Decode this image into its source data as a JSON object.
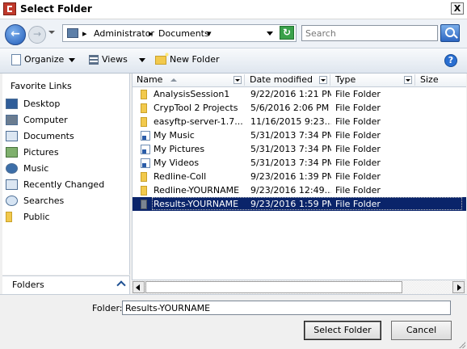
{
  "window": {
    "title": "Select Folder",
    "close_label": "X"
  },
  "address_bar": {
    "breadcrumb": [
      "Administrator",
      "Documents"
    ],
    "search_placeholder": "Search"
  },
  "toolbar": {
    "organize_label": "Organize",
    "views_label": "Views",
    "new_folder_label": "New Folder",
    "help_label": "?"
  },
  "nav_pane": {
    "heading": "Favorite Links",
    "items": [
      {
        "label": "Desktop",
        "icon": "desktop-icon"
      },
      {
        "label": "Computer",
        "icon": "computer-icon"
      },
      {
        "label": "Documents",
        "icon": "documents-icon"
      },
      {
        "label": "Pictures",
        "icon": "pictures-icon"
      },
      {
        "label": "Music",
        "icon": "music-icon"
      },
      {
        "label": "Recently Changed",
        "icon": "recently-changed-icon"
      },
      {
        "label": "Searches",
        "icon": "searches-icon"
      },
      {
        "label": "Public",
        "icon": "folder-icon"
      }
    ],
    "folders_label": "Folders"
  },
  "file_list": {
    "columns": [
      "Name",
      "Date modified",
      "Type",
      "Size"
    ],
    "rows": [
      {
        "name": "AnalysisSession1",
        "date": "9/22/2016 1:21 PM",
        "type": "File Folder",
        "icon": "folder-icon"
      },
      {
        "name": "CrypTool 2 Projects",
        "date": "5/6/2016 2:06 PM",
        "type": "File Folder",
        "icon": "folder-icon"
      },
      {
        "name": "easyftp-server-1.7....",
        "date": "11/16/2015 9:23...",
        "type": "File Folder",
        "icon": "folder-icon"
      },
      {
        "name": "My Music",
        "date": "5/31/2013 7:34 PM",
        "type": "File Folder",
        "icon": "shortcut-folder-icon"
      },
      {
        "name": "My Pictures",
        "date": "5/31/2013 7:34 PM",
        "type": "File Folder",
        "icon": "shortcut-folder-icon"
      },
      {
        "name": "My Videos",
        "date": "5/31/2013 7:34 PM",
        "type": "File Folder",
        "icon": "shortcut-folder-icon"
      },
      {
        "name": "Redline-Coll",
        "date": "9/23/2016 1:39 PM",
        "type": "File Folder",
        "icon": "folder-icon"
      },
      {
        "name": "Redline-YOURNAME",
        "date": "9/23/2016 12:49...",
        "type": "File Folder",
        "icon": "folder-icon"
      },
      {
        "name": "Results-YOURNAME",
        "date": "9/23/2016 1:59 PM",
        "type": "File Folder",
        "icon": "folder-icon",
        "selected": true
      }
    ]
  },
  "footer": {
    "folder_label": "Folder:",
    "folder_value": "Results-YOURNAME",
    "select_button": "Select Folder",
    "cancel_button": "Cancel"
  },
  "colors": {
    "selection": "#0a246a",
    "title_icon": "#c0392b",
    "folder": "#f2c94c"
  }
}
